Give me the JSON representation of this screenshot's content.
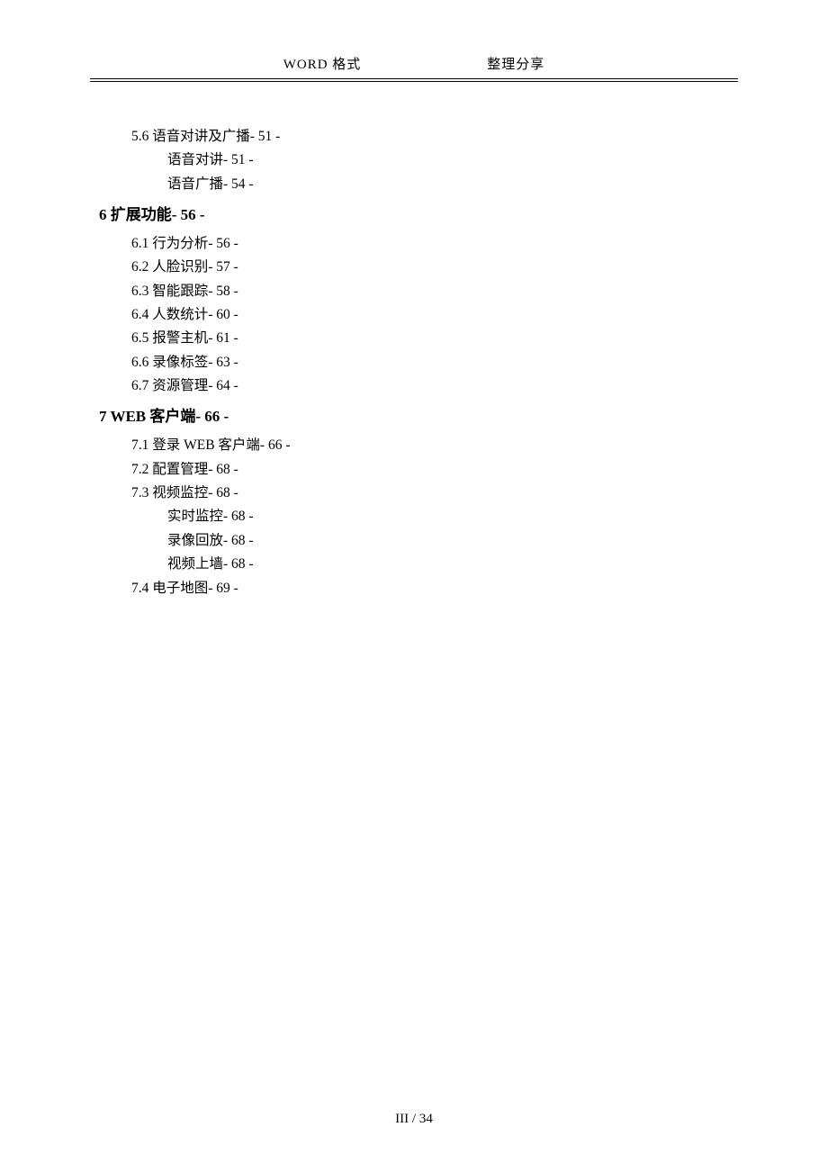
{
  "header": {
    "left": "WORD 格式",
    "right": "整理分享"
  },
  "toc": {
    "sec5": {
      "s56": "5.6  语音对讲及广播- 51 -",
      "s56a": "语音对讲- 51 -",
      "s56b": "语音广播- 54 -"
    },
    "sec6_heading": "6  扩展功能- 56 -",
    "sec6": {
      "s61": "6.1  行为分析- 56 -",
      "s62": "6.2  人脸识别- 57 -",
      "s63": "6.3  智能跟踪- 58 -",
      "s64": "6.4  人数统计- 60 -",
      "s65": "6.5  报警主机- 61 -",
      "s66": "6.6  录像标签- 63 -",
      "s67": "6.7  资源管理- 64 -"
    },
    "sec7_heading": "7 WEB 客户端- 66 -",
    "sec7": {
      "s71": "7.1  登录 WEB 客户端- 66 -",
      "s72": "7.2  配置管理- 68 -",
      "s73": "7.3  视频监控- 68 -",
      "s73a": "实时监控- 68 -",
      "s73b": "录像回放- 68 -",
      "s73c": "视频上墙- 68 -",
      "s74": "7.4  电子地图- 69 -"
    }
  },
  "footer": "III  / 34"
}
